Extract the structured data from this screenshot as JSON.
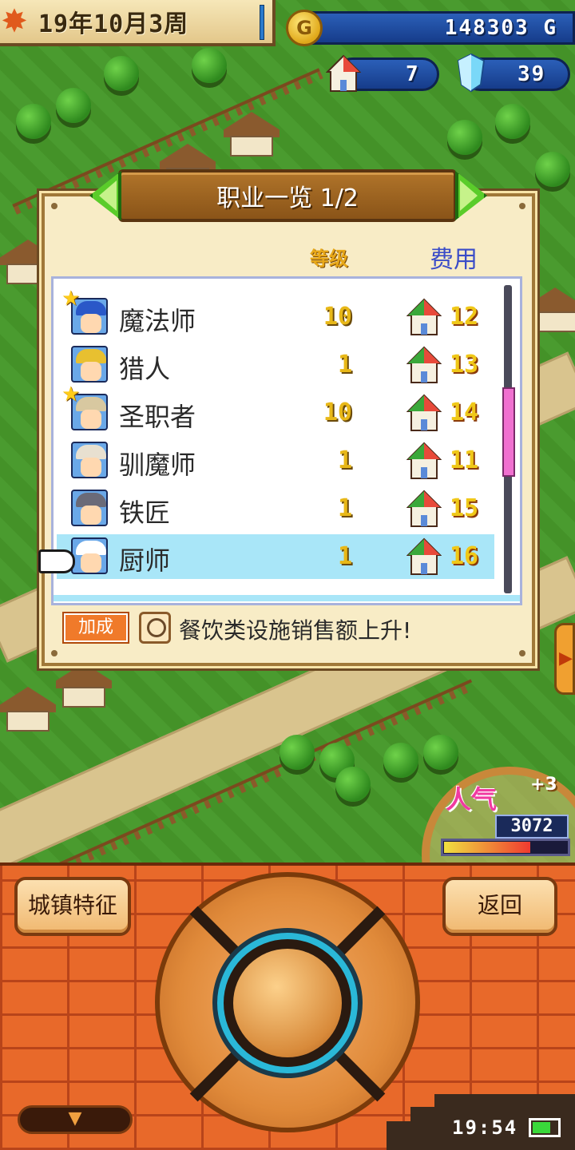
{
  "hud": {
    "date": "19年10月3周",
    "gold": "148303 G",
    "gold_icon": "G",
    "houses": "7",
    "crystals": "39"
  },
  "dialog": {
    "title": "职业一览 1/2",
    "header_level": "等级",
    "header_cost": "费用",
    "jobs": [
      {
        "name": "魔法师",
        "level": "10",
        "cost": "12",
        "starred": true,
        "hat_color": "#2a58c8",
        "avatar_icon": "mage-avatar-icon"
      },
      {
        "name": "猎人",
        "level": "1",
        "cost": "13",
        "starred": false,
        "hat_color": "#e8c030",
        "avatar_icon": "hunter-avatar-icon"
      },
      {
        "name": "圣职者",
        "level": "10",
        "cost": "14",
        "starred": true,
        "hat_color": "#d8c8a0",
        "avatar_icon": "priest-avatar-icon"
      },
      {
        "name": "驯魔师",
        "level": "1",
        "cost": "11",
        "starred": false,
        "hat_color": "#e8e0d0",
        "avatar_icon": "tamer-avatar-icon"
      },
      {
        "name": "铁匠",
        "level": "1",
        "cost": "15",
        "starred": false,
        "hat_color": "#6a6a78",
        "avatar_icon": "blacksmith-avatar-icon"
      },
      {
        "name": "厨师",
        "level": "1",
        "cost": "16",
        "starred": false,
        "hat_color": "#ffffff",
        "avatar_icon": "chef-avatar-icon",
        "selected": true
      }
    ],
    "bonus_badge": "加成",
    "bonus_text": "餐饮类设施销售额上升!"
  },
  "popularity": {
    "label": "人气",
    "delta": "+3",
    "value": "3072",
    "level_fraction": 0.7
  },
  "controls": {
    "town_features": "城镇特征",
    "back": "返回",
    "menu_toggle_icon": "▼"
  },
  "status": {
    "clock": "19:54"
  },
  "colors": {
    "selected_row": "#a9e6f8",
    "level_text": "#e8b818",
    "cost_header": "#3a4cc8",
    "scroll_thumb": "#f070d0"
  }
}
